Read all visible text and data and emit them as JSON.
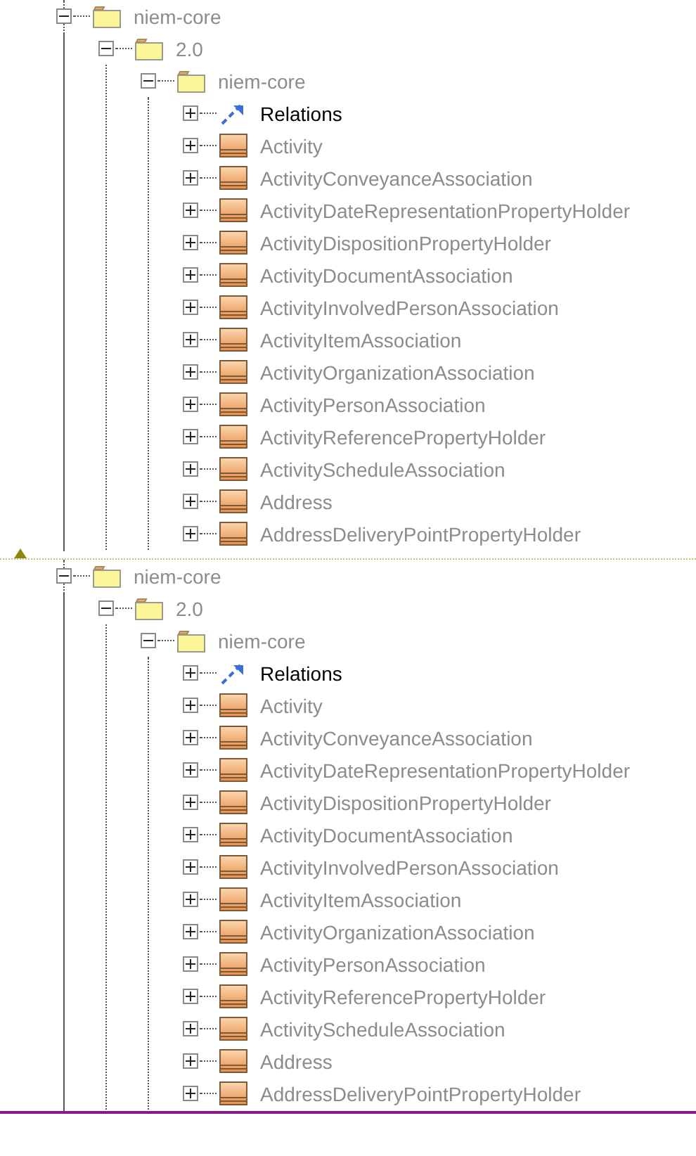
{
  "panels": [
    {
      "nodes": [
        {
          "label": "niem-core",
          "kind": "folder",
          "expanded": true,
          "children": [
            {
              "label": "2.0",
              "kind": "folder",
              "expanded": true,
              "children": [
                {
                  "label": "niem-core",
                  "kind": "folder",
                  "expanded": true,
                  "children": [
                    {
                      "label": "Relations",
                      "kind": "relations",
                      "expanded": false
                    },
                    {
                      "label": "Activity",
                      "kind": "class",
                      "expanded": false
                    },
                    {
                      "label": "ActivityConveyanceAssociation",
                      "kind": "class",
                      "expanded": false
                    },
                    {
                      "label": "ActivityDateRepresentationPropertyHolder",
                      "kind": "class",
                      "expanded": false
                    },
                    {
                      "label": "ActivityDispositionPropertyHolder",
                      "kind": "class",
                      "expanded": false
                    },
                    {
                      "label": "ActivityDocumentAssociation",
                      "kind": "class",
                      "expanded": false
                    },
                    {
                      "label": "ActivityInvolvedPersonAssociation",
                      "kind": "class",
                      "expanded": false
                    },
                    {
                      "label": "ActivityItemAssociation",
                      "kind": "class",
                      "expanded": false
                    },
                    {
                      "label": "ActivityOrganizationAssociation",
                      "kind": "class",
                      "expanded": false
                    },
                    {
                      "label": "ActivityPersonAssociation",
                      "kind": "class",
                      "expanded": false
                    },
                    {
                      "label": "ActivityReferencePropertyHolder",
                      "kind": "class",
                      "expanded": false
                    },
                    {
                      "label": "ActivityScheduleAssociation",
                      "kind": "class",
                      "expanded": false
                    },
                    {
                      "label": "Address",
                      "kind": "class",
                      "expanded": false
                    },
                    {
                      "label": "AddressDeliveryPointPropertyHolder",
                      "kind": "class",
                      "expanded": false
                    }
                  ]
                }
              ]
            }
          ]
        }
      ]
    },
    {
      "nodes": [
        {
          "label": "niem-core",
          "kind": "folder",
          "expanded": true,
          "children": [
            {
              "label": "2.0",
              "kind": "folder",
              "expanded": true,
              "children": [
                {
                  "label": "niem-core",
                  "kind": "folder",
                  "expanded": true,
                  "children": [
                    {
                      "label": "Relations",
                      "kind": "relations",
                      "expanded": false
                    },
                    {
                      "label": "Activity",
                      "kind": "class",
                      "expanded": false
                    },
                    {
                      "label": "ActivityConveyanceAssociation",
                      "kind": "class",
                      "expanded": false
                    },
                    {
                      "label": "ActivityDateRepresentationPropertyHolder",
                      "kind": "class",
                      "expanded": false
                    },
                    {
                      "label": "ActivityDispositionPropertyHolder",
                      "kind": "class",
                      "expanded": false
                    },
                    {
                      "label": "ActivityDocumentAssociation",
                      "kind": "class",
                      "expanded": false
                    },
                    {
                      "label": "ActivityInvolvedPersonAssociation",
                      "kind": "class",
                      "expanded": false
                    },
                    {
                      "label": "ActivityItemAssociation",
                      "kind": "class",
                      "expanded": false
                    },
                    {
                      "label": "ActivityOrganizationAssociation",
                      "kind": "class",
                      "expanded": false
                    },
                    {
                      "label": "ActivityPersonAssociation",
                      "kind": "class",
                      "expanded": false
                    },
                    {
                      "label": "ActivityReferencePropertyHolder",
                      "kind": "class",
                      "expanded": false
                    },
                    {
                      "label": "ActivityScheduleAssociation",
                      "kind": "class",
                      "expanded": false
                    },
                    {
                      "label": "Address",
                      "kind": "class",
                      "expanded": false
                    },
                    {
                      "label": "AddressDeliveryPointPropertyHolder",
                      "kind": "class",
                      "expanded": false
                    }
                  ]
                }
              ]
            }
          ]
        }
      ]
    }
  ]
}
